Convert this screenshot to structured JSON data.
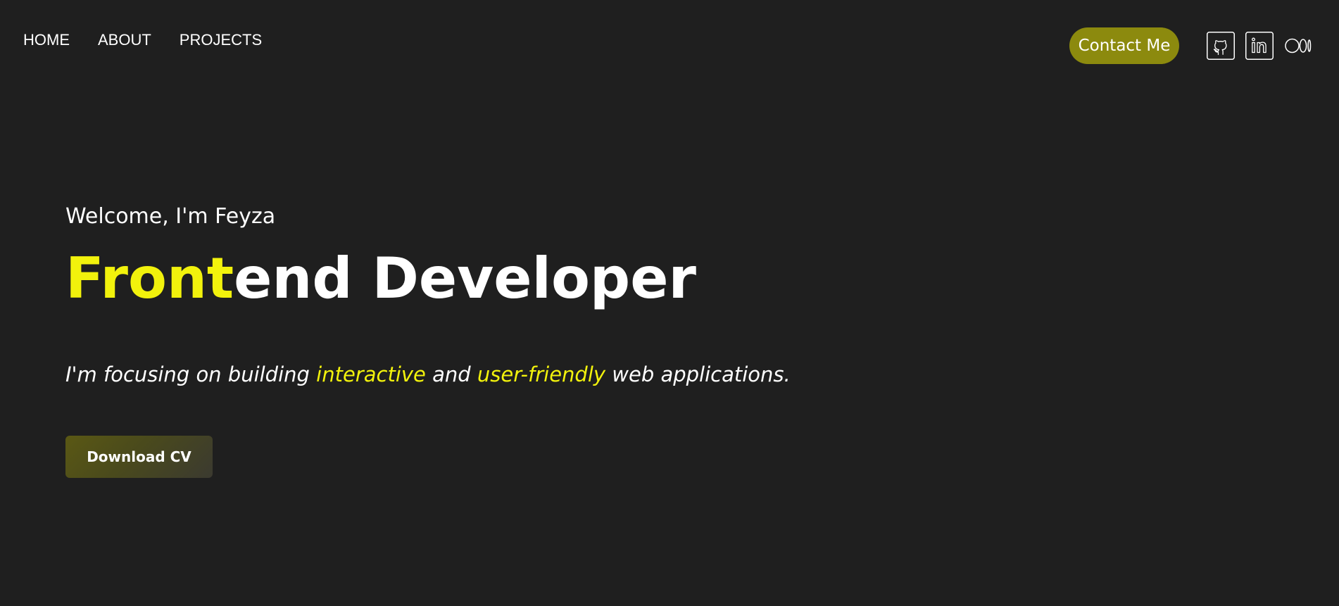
{
  "nav": {
    "links": [
      {
        "label": "HOME"
      },
      {
        "label": "ABOUT"
      },
      {
        "label": "PROJECTS"
      }
    ],
    "contact_label": "Contact Me",
    "social_icons": [
      "github-icon",
      "linkedin-icon",
      "medium-icon"
    ]
  },
  "hero": {
    "welcome": "Welcome, I'm Feyza",
    "headline_highlight": "Front",
    "headline_rest": "end Developer",
    "tagline": {
      "part1": "I'm focusing on building ",
      "highlight1": "interactive",
      "part2": " and ",
      "highlight2": "user-friendly",
      "part3": " web applications."
    },
    "download_label": "Download CV"
  },
  "colors": {
    "background": "#1f1f1f",
    "accent": "#f2f20c",
    "contact_button": "#8c8a0e",
    "download_button": "#4a4a1c",
    "text": "#ffffff"
  }
}
